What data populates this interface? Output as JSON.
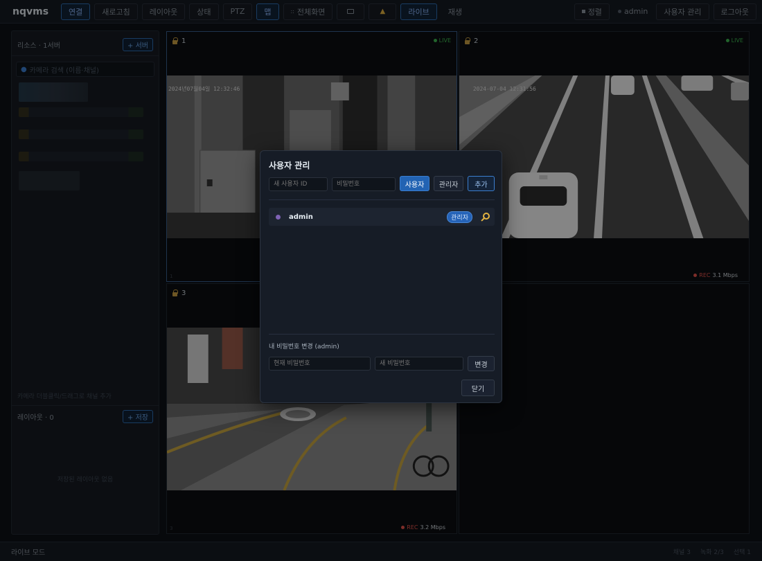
{
  "app": {
    "brand": "nqvms"
  },
  "topbar": {
    "buttons": [
      {
        "label": "연결",
        "active": true
      },
      {
        "label": "새로고침"
      },
      {
        "label": "레이아웃"
      },
      {
        "label": "상태"
      },
      {
        "label": "PTZ"
      },
      {
        "label": "맵",
        "active": true
      },
      {
        "label": "전체화면"
      },
      {
        "label": "",
        "icon": "keyboard-icon"
      },
      {
        "label": "",
        "icon": "bell-icon"
      },
      {
        "label": "라이브",
        "active": true
      },
      {
        "label": "재생"
      }
    ],
    "sort_label": "정렬",
    "user_name": "admin",
    "user_manage_label": "사용자 관리",
    "logout_label": "로그아웃"
  },
  "sidebar": {
    "resources_label": "리소스",
    "resources_count": "1서버",
    "add_server_label": "+ 서버",
    "search_placeholder": "카메라 검색 (이름·채널)",
    "hint": "카메라 더블클릭/드래그로 채널 추가",
    "layouts_label": "레이아웃",
    "layouts_count": "0",
    "save_layout_label": "+ 저장",
    "no_layouts": "저장된 레이아웃 없음"
  },
  "tiles": [
    {
      "id": "1",
      "live": "LIVE",
      "footer_index": "1"
    },
    {
      "id": "2",
      "live": "LIVE",
      "rec": "REC",
      "bitrate": "3.1 Mbps"
    },
    {
      "id": "3",
      "rec": "REC",
      "bitrate": "3.2 Mbps",
      "footer_index": "3"
    }
  ],
  "cam1_timestamp": "2024년07월04일 12:32:46",
  "cam2_timestamp": "2024-07-04 12:31:56",
  "statusbar": {
    "mode": "라이브 모드",
    "right": [
      "채널 3",
      "녹화 2/3",
      "선택 1"
    ]
  },
  "modal": {
    "title": "사용자 관리",
    "new_id_placeholder": "새 사용자 ID",
    "new_pw_placeholder": "비밀번호",
    "role_user": "사용자",
    "role_admin": "관리자",
    "add_label": "추가",
    "users": [
      {
        "name": "admin",
        "role": "관리자"
      }
    ],
    "password_section": "내 비밀번호 변경 (admin)",
    "current_pw_placeholder": "현재 비밀번호",
    "new_pw2_placeholder": "새 비밀번호",
    "change_label": "변경",
    "close_label": "닫기"
  },
  "colors": {
    "accent": "#2263b3",
    "live": "#3fb950",
    "rec": "#e5534b",
    "lock": "#c69d43"
  }
}
